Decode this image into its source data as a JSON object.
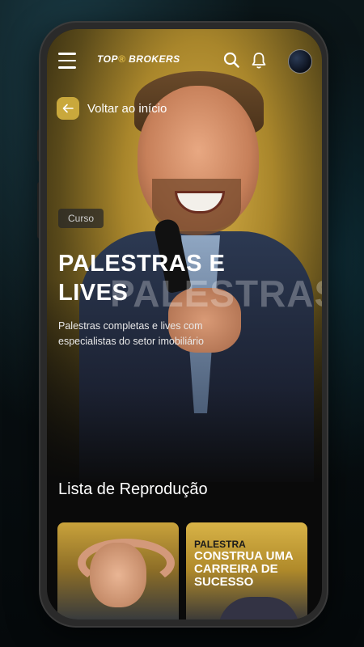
{
  "app": {
    "logo_main": "TOP",
    "logo_accent": "BROKERS"
  },
  "navigation": {
    "back_label": "Voltar ao início"
  },
  "hero": {
    "tag": "Curso",
    "title": "PALESTRAS E LIVES",
    "watermark": "PALESTRAS",
    "description": "Palestras completas e lives com especialistas do setor imobiliário"
  },
  "playlist": {
    "title": "Lista de Reprodução",
    "cards": [
      {
        "tag": "",
        "title": ""
      },
      {
        "tag": "PALESTRA",
        "title": "CONSTRUA UMA CARREIRA DE SUCESSO"
      }
    ]
  },
  "colors": {
    "accent": "#c9a83c",
    "background": "#0a0a0a"
  }
}
